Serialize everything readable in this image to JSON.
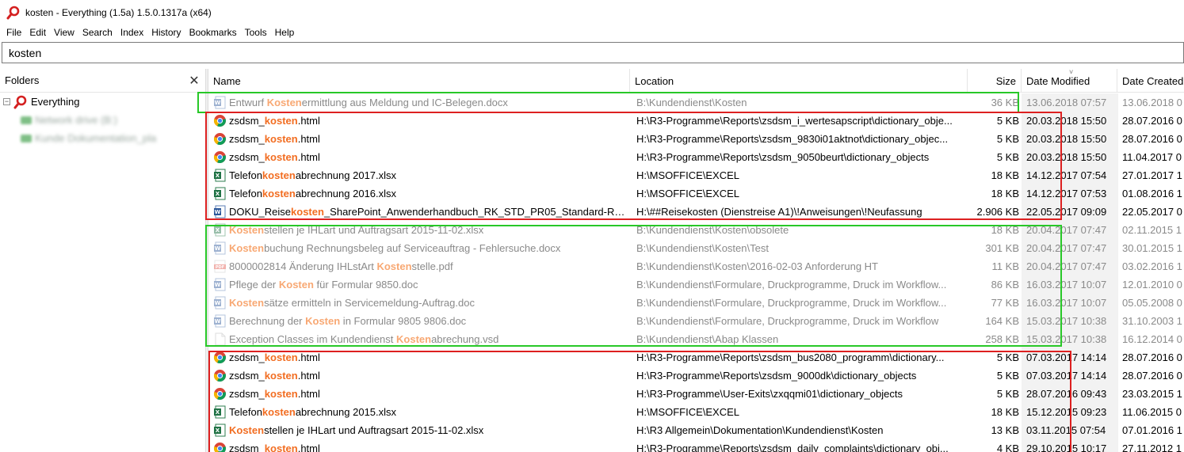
{
  "window": {
    "title": "kosten - Everything (1.5a) 1.5.0.1317a (x64)"
  },
  "menu": [
    "File",
    "Edit",
    "View",
    "Search",
    "Index",
    "History",
    "Bookmarks",
    "Tools",
    "Help"
  ],
  "search": {
    "value": "kosten"
  },
  "folders": {
    "header": "Folders",
    "root_label": "Everything",
    "root_expander": "−",
    "blurred_items": [
      "Network drive (B:)",
      "Kunde Dokumentation_pla"
    ]
  },
  "columns": {
    "name": "Name",
    "location": "Location",
    "size": "Size",
    "date_modified": "Date Modified",
    "date_created": "Date Created"
  },
  "colors": {
    "highlight": "#f26d21",
    "green_frame": "#28c828",
    "red_frame": "#dd2020"
  },
  "rows": [
    {
      "pre": "Entwurf ",
      "hl": "Kosten",
      "post": "ermittlung aus Meldung und IC-Belegen.docx",
      "icon": "word-icon",
      "location": "B:\\Kundendienst\\Kosten",
      "size": "36 KB",
      "modified": "13.06.2018 07:57",
      "created": "13.06.2018 0",
      "dim": true
    },
    {
      "pre": "zsdsm_",
      "hl": "kosten",
      "post": ".html",
      "icon": "chrome-icon",
      "location": "H:\\R3-Programme\\Reports\\zsdsm_i_wertesapscript\\dictionary_obje...",
      "size": "5 KB",
      "modified": "20.03.2018 15:50",
      "created": "28.07.2016 0",
      "dim": false
    },
    {
      "pre": "zsdsm_",
      "hl": "kosten",
      "post": ".html",
      "icon": "chrome-icon",
      "location": "H:\\R3-Programme\\Reports\\zsdsm_9830i01aktnot\\dictionary_objec...",
      "size": "5 KB",
      "modified": "20.03.2018 15:50",
      "created": "28.07.2016 0",
      "dim": false
    },
    {
      "pre": "zsdsm_",
      "hl": "kosten",
      "post": ".html",
      "icon": "chrome-icon",
      "location": "H:\\R3-Programme\\Reports\\zsdsm_9050beurt\\dictionary_objects",
      "size": "5 KB",
      "modified": "20.03.2018 15:50",
      "created": "11.04.2017 0",
      "dim": false
    },
    {
      "pre": "Telefon",
      "hl": "kosten",
      "post": "abrechnung 2017.xlsx",
      "icon": "excel-icon",
      "location": "H:\\MSOFFICE\\EXCEL",
      "size": "18 KB",
      "modified": "14.12.2017 07:54",
      "created": "27.01.2017 1",
      "dim": false
    },
    {
      "pre": "Telefon",
      "hl": "kosten",
      "post": "abrechnung 2016.xlsx",
      "icon": "excel-icon",
      "location": "H:\\MSOFFICE\\EXCEL",
      "size": "18 KB",
      "modified": "14.12.2017 07:53",
      "created": "01.08.2016 1",
      "dim": false
    },
    {
      "pre": "DOKU_Reise",
      "hl": "kosten",
      "post": "_SharePoint_Anwenderhandbuch_RK_STD_PR05_Standard-Rei...",
      "icon": "word-icon",
      "location": "H:\\##Reisekosten (Dienstreise A1)\\!Anweisungen\\!Neufassung",
      "size": "2.906 KB",
      "modified": "22.05.2017 09:09",
      "created": "22.05.2017 0",
      "dim": false
    },
    {
      "pre": "",
      "hl": "Kosten",
      "post": "stellen je IHLart und Auftragsart 2015-11-02.xlsx",
      "icon": "excel-icon",
      "location": "B:\\Kundendienst\\Kosten\\obsolete",
      "size": "18 KB",
      "modified": "20.04.2017 07:47",
      "created": "02.11.2015 1",
      "dim": true
    },
    {
      "pre": "",
      "hl": "Kosten",
      "post": "buchung Rechnungsbeleg auf Serviceauftrag - Fehlersuche.docx",
      "icon": "word-icon",
      "location": "B:\\Kundendienst\\Kosten\\Test",
      "size": "301 KB",
      "modified": "20.04.2017 07:47",
      "created": "30.01.2015 1",
      "dim": true
    },
    {
      "pre": "8000002814 Änderung IHLstArt  ",
      "hl": "Kosten",
      "post": "stelle.pdf",
      "icon": "pdf-icon",
      "location": "B:\\Kundendienst\\Kosten\\2016-02-03 Anforderung HT",
      "size": "11 KB",
      "modified": "20.04.2017 07:47",
      "created": "03.02.2016 1",
      "dim": true
    },
    {
      "pre": "Pflege der ",
      "hl": "Kosten",
      "post": " für Formular 9850.doc",
      "icon": "word-icon",
      "location": "B:\\Kundendienst\\Formulare, Druckprogramme, Druck im Workflow...",
      "size": "86 KB",
      "modified": "16.03.2017 10:07",
      "created": "12.01.2010 0",
      "dim": true
    },
    {
      "pre": "",
      "hl": "Kosten",
      "post": "sätze ermitteln in Servicemeldung-Auftrag.doc",
      "icon": "word-icon",
      "location": "B:\\Kundendienst\\Formulare, Druckprogramme, Druck im Workflow...",
      "size": "77 KB",
      "modified": "16.03.2017 10:07",
      "created": "05.05.2008 0",
      "dim": true
    },
    {
      "pre": "Berechnung der ",
      "hl": "Kosten",
      "post": " in Formular 9805 9806.doc",
      "icon": "word-icon",
      "location": "B:\\Kundendienst\\Formulare, Druckprogramme, Druck im Workflow",
      "size": "164 KB",
      "modified": "15.03.2017 10:38",
      "created": "31.10.2003 1",
      "dim": true
    },
    {
      "pre": "Exception Classes im Kundendienst ",
      "hl": "Kosten",
      "post": "abrechung.vsd",
      "icon": "file-icon",
      "location": "B:\\Kundendienst\\Abap Klassen",
      "size": "258 KB",
      "modified": "15.03.2017 10:38",
      "created": "16.12.2014 0",
      "dim": true
    },
    {
      "pre": "zsdsm_",
      "hl": "kosten",
      "post": ".html",
      "icon": "chrome-icon",
      "location": "H:\\R3-Programme\\Reports\\zsdsm_bus2080_programm\\dictionary...",
      "size": "5 KB",
      "modified": "07.03.2017 14:14",
      "created": "28.07.2016 0",
      "dim": false
    },
    {
      "pre": "zsdsm_",
      "hl": "kosten",
      "post": ".html",
      "icon": "chrome-icon",
      "location": "H:\\R3-Programme\\Reports\\zsdsm_9000dk\\dictionary_objects",
      "size": "5 KB",
      "modified": "07.03.2017 14:14",
      "created": "28.07.2016 0",
      "dim": false
    },
    {
      "pre": "zsdsm_",
      "hl": "kosten",
      "post": ".html",
      "icon": "chrome-icon",
      "location": "H:\\R3-Programme\\User-Exits\\zxqqmi01\\dictionary_objects",
      "size": "5 KB",
      "modified": "28.07.2016 09:43",
      "created": "23.03.2015 1",
      "dim": false
    },
    {
      "pre": "Telefon",
      "hl": "kosten",
      "post": "abrechnung 2015.xlsx",
      "icon": "excel-icon",
      "location": "H:\\MSOFFICE\\EXCEL",
      "size": "18 KB",
      "modified": "15.12.2015 09:23",
      "created": "11.06.2015 0",
      "dim": false
    },
    {
      "pre": "",
      "hl": "Kosten",
      "post": "stellen je IHLart und Auftragsart 2015-11-02.xlsx",
      "icon": "excel-icon",
      "location": "H:\\R3 Allgemein\\Dokumentation\\Kundendienst\\Kosten",
      "size": "13 KB",
      "modified": "03.11.2015 07:54",
      "created": "07.01.2016 1",
      "dim": false
    },
    {
      "pre": "zsdsm_",
      "hl": "kosten",
      "post": ".html",
      "icon": "chrome-icon",
      "location": "H:\\R3-Programme\\Reports\\zsdsm_daily_complaints\\dictionary_obj...",
      "size": "4 KB",
      "modified": "29.10.2015 10:17",
      "created": "27.11.2012 1",
      "dim": false
    }
  ]
}
